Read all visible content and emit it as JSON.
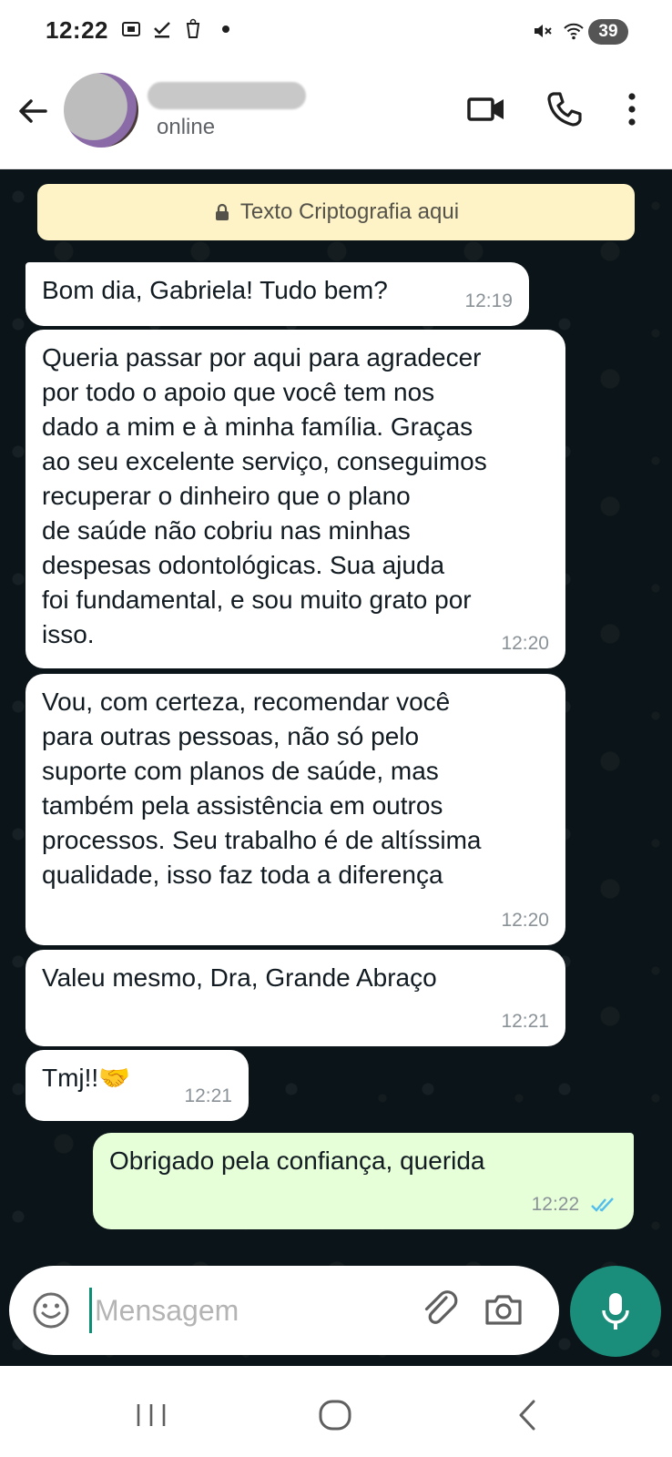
{
  "status_bar": {
    "time": "12:22",
    "battery": "39",
    "left_icons": [
      "screenshot-icon",
      "check-download-icon",
      "alarm-cup-icon"
    ],
    "right_icons": [
      "mute-icon",
      "wifi-icon",
      "signal-icon"
    ]
  },
  "header": {
    "contact_status": "online",
    "actions": [
      "video-call-icon",
      "voice-call-icon",
      "more-options-icon"
    ]
  },
  "chat": {
    "encryption_banner": "Texto Criptografia aqui",
    "messages": [
      {
        "direction": "incoming",
        "text": "Bom dia, Gabriela! Tudo bem?",
        "time": "12:19"
      },
      {
        "direction": "incoming",
        "text": "Queria passar por aqui para agradecer\npor todo o apoio que você tem nos\ndado a mim e à minha família. Graças\nao seu excelente serviço, conseguimos\nrecuperar o dinheiro que o plano\nde saúde não cobriu nas minhas\ndespesas odontológicas. Sua ajuda\nfoi fundamental, e sou muito grato por\nisso.",
        "time": "12:20"
      },
      {
        "direction": "incoming",
        "text": "Vou, com certeza, recomendar você\npara outras pessoas, não só pelo\nsuporte com planos de saúde, mas\ntambém pela assistência em outros\nprocessos. Seu trabalho é de altíssima\nqualidade, isso faz toda a diferença",
        "time": "12:20"
      },
      {
        "direction": "incoming",
        "text": "Valeu mesmo, Dra, Grande Abraço",
        "time": "12:21"
      },
      {
        "direction": "incoming",
        "text": "Tmj!!🤝",
        "time": "12:21"
      },
      {
        "direction": "outgoing",
        "text": "Obrigado pela confiança, querida",
        "time": "12:22",
        "status": "read"
      }
    ]
  },
  "composer": {
    "placeholder": "Mensagem"
  },
  "colors": {
    "chat_background": "#0b141a",
    "outgoing_bubble": "#e7ffd9",
    "incoming_bubble": "#ffffff",
    "banner": "#fdf3c6",
    "accent": "#1a8e7a",
    "read_ticks": "#53bdeb"
  }
}
